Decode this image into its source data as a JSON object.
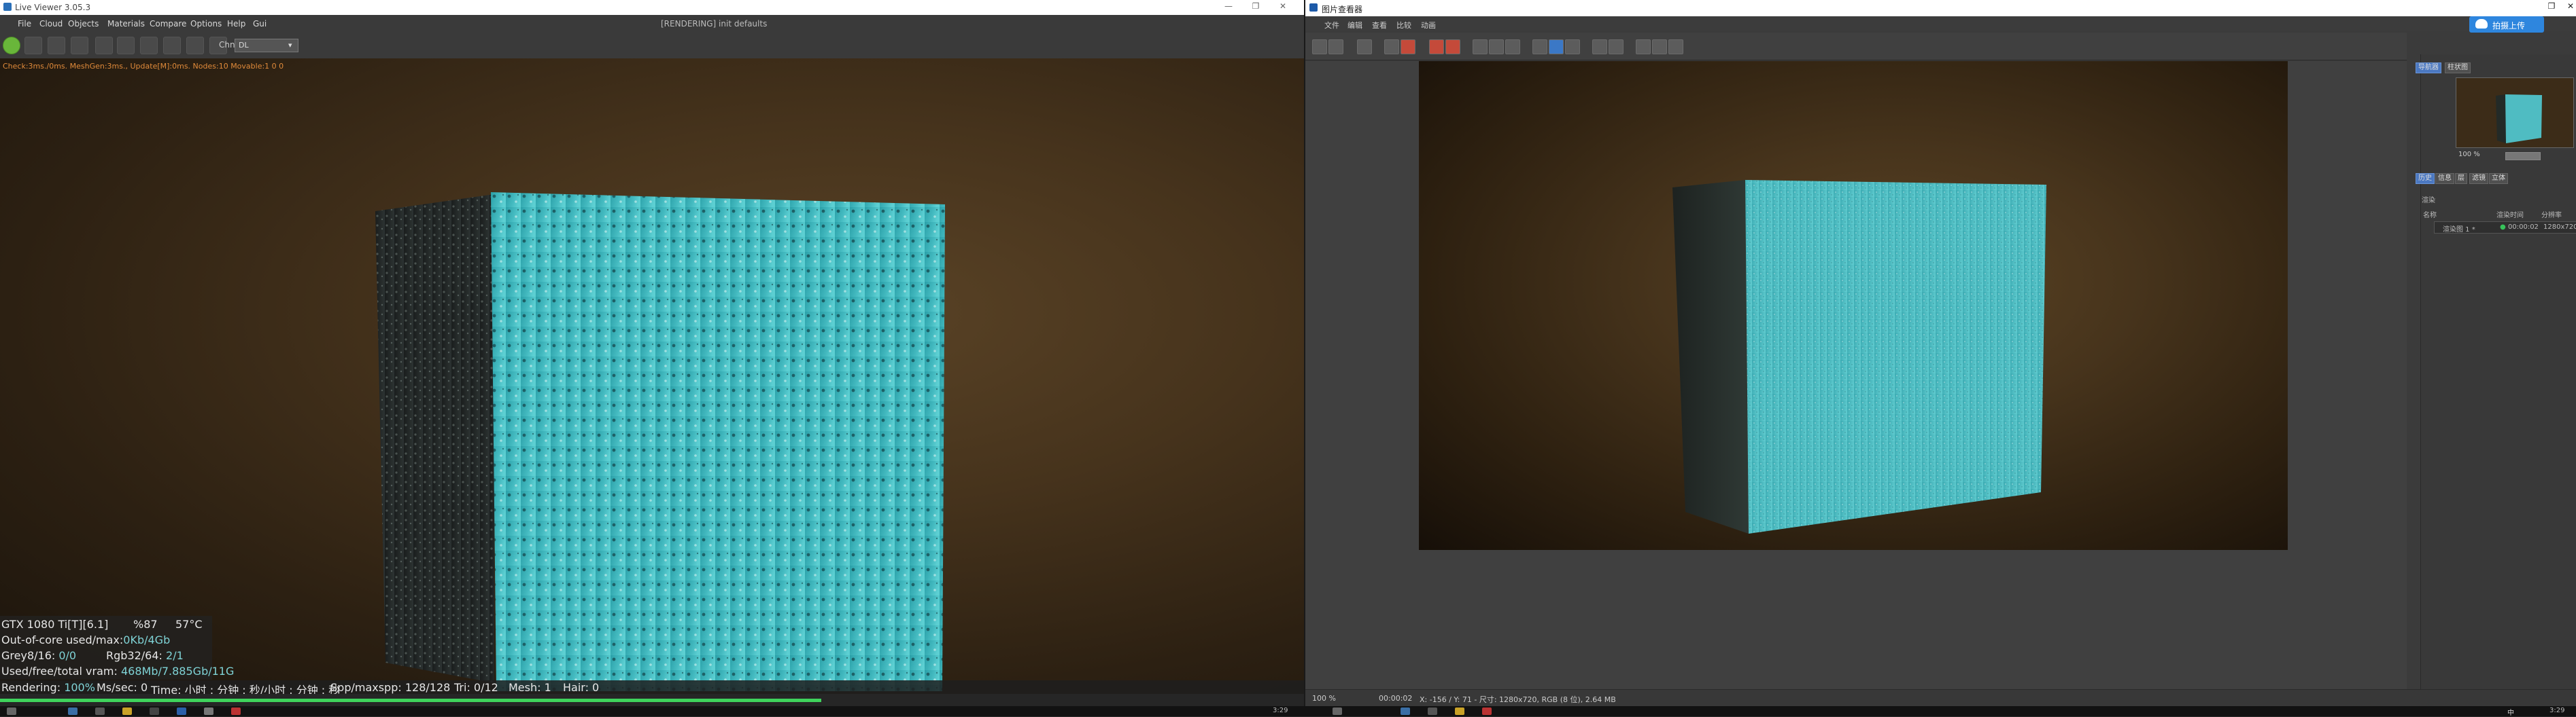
{
  "live_viewer": {
    "title": "Live Viewer 3.05.3",
    "menu": [
      "File",
      "Cloud",
      "Objects",
      "Materials",
      "Compare",
      "Options",
      "Help",
      "Gui"
    ],
    "render_status": "[RENDERING] init defaults",
    "camera_select": {
      "prefix": "Chn",
      "value": "DL"
    },
    "info_line": "Check:3ms./0ms. MeshGen:3ms., Update[M]:0ms. Nodes:10 Movable:1 0 0",
    "stats": {
      "gpu": "GTX 1080 Ti[T][6.1]",
      "gpu_load": "%87",
      "gpu_temp": "57°C",
      "out_of_core_label": "Out-of-core used/max:",
      "out_of_core_value": "0Kb/4Gb",
      "grey_label": "Grey8/16:",
      "grey_value": "0/0",
      "rgb_label": "Rgb32/64:",
      "rgb_value": "2/1",
      "vram_label": "Used/free/total vram:",
      "vram_value": "468Mb/7.885Gb/11G"
    },
    "status": {
      "rendering_label": "Rendering:",
      "rendering_value": "100%",
      "ms_label": "Ms/sec: 0",
      "time_label": "Time: 小时 : 分钟 : 秒/小时 : 分钟 : 秒",
      "spp_label": "Spp/maxspp: 128/128",
      "tri_label": "Tri: 0/12",
      "mesh_label": "Mesh: 1",
      "hair_label": "Hair: 0"
    },
    "progress": 0.63
  },
  "picture_viewer": {
    "title": "图片查看器",
    "menu": [
      "文件",
      "编辑",
      "查看",
      "比较",
      "动画"
    ],
    "upload_button": "拍摄上传",
    "tabs_top": [
      "导航器",
      "柱状图"
    ],
    "zoom_value": "100 %",
    "tabs_mid": [
      "历史",
      "信息",
      "层",
      "滤镜",
      "立体"
    ],
    "history_label": "渲染",
    "col_name": "名称",
    "col_time": "渲染时间",
    "col_res": "分辨率",
    "row_name": "渲染图 1 *",
    "row_time": "00:00:02",
    "row_res": "1280x720",
    "status": {
      "zoom": "100 %",
      "time": "00:00:02",
      "info": "X: -156 / Y: 71 - 尺寸: 1280x720, RGB (8 位), 2.64 MB"
    }
  },
  "taskbar": {
    "clock_left": "3:29",
    "clock_right": "3:29",
    "ime": "中"
  },
  "colors": {
    "accent_green": "#3fd35c",
    "stat_value": "#7fd3d6",
    "info_orange": "#e08a3a",
    "upload_blue": "#2e86de"
  }
}
